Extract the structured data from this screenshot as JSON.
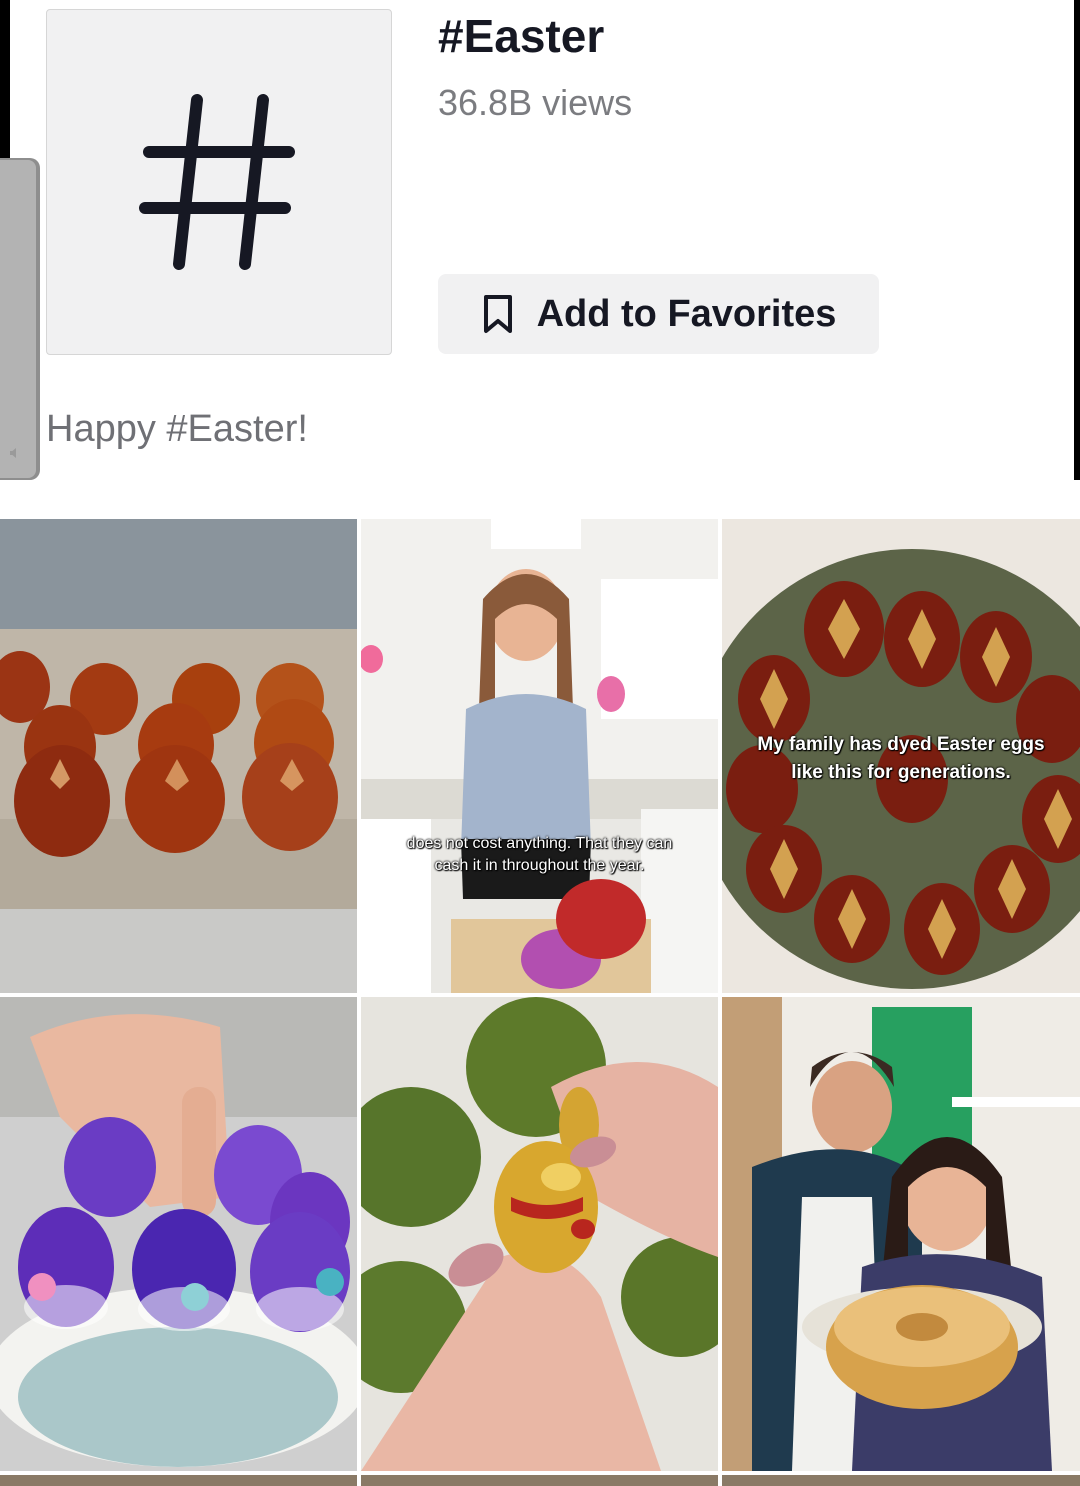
{
  "header": {
    "title": "#Easter",
    "views": "36.8B views",
    "favorite_label": "Add to Favorites",
    "hashtag_glyph": "#",
    "description": "Happy #Easter!"
  },
  "icons": {
    "hashtag": "hashtag-icon",
    "bookmark": "bookmark-icon"
  },
  "videos": [
    {
      "caption": ""
    },
    {
      "caption": "does not cost anything. That they can cash it in throughout the year."
    },
    {
      "caption": "My family has dyed Easter eggs like this for generations."
    },
    {
      "caption": ""
    },
    {
      "caption": ""
    },
    {
      "caption": ""
    }
  ],
  "colors": {
    "text_primary": "#161823",
    "text_secondary": "#7b7c80",
    "button_bg": "#f1f1f2"
  }
}
